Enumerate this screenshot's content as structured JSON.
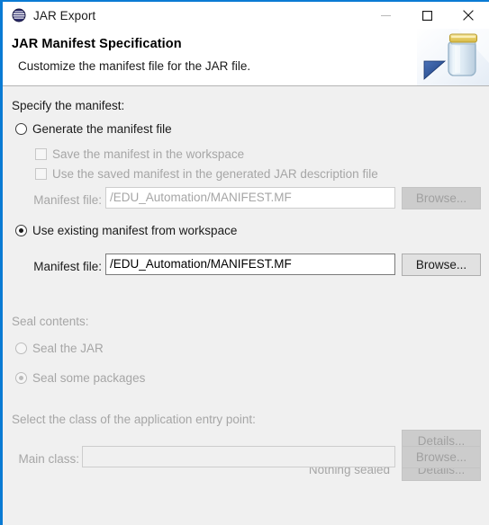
{
  "window": {
    "title": "JAR Export",
    "app_icon": "eclipse-icon",
    "accent_color": "#0a7bd4",
    "controls": {
      "minimize": "minimize-icon",
      "maximize": "maximize-icon",
      "close": "close-icon"
    }
  },
  "header": {
    "title": "JAR Manifest Specification",
    "subtitle": "Customize the manifest file for the JAR file.",
    "banner_icon": "jar-export-icon"
  },
  "manifest_section": {
    "label": "Specify the manifest:",
    "generate_option": {
      "label": "Generate the manifest file",
      "selected": false,
      "enabled": true
    },
    "save_in_workspace": {
      "label": "Save the manifest in the workspace",
      "checked": false,
      "enabled": false
    },
    "use_saved_manifest": {
      "label": "Use the saved manifest in the generated JAR description file",
      "checked": false,
      "enabled": false
    },
    "generate_manifest_file": {
      "label": "Manifest file:",
      "value": "/EDU_Automation/MANIFEST.MF",
      "browse_label": "Browse...",
      "enabled": false
    },
    "use_existing_option": {
      "label": "Use existing manifest from workspace",
      "selected": true,
      "enabled": true
    },
    "existing_manifest_file": {
      "label": "Manifest file:",
      "value": "/EDU_Automation/MANIFEST.MF",
      "browse_label": "Browse...",
      "enabled": true
    }
  },
  "seal_section": {
    "label": "Seal contents:",
    "enabled": false,
    "seal_jar": {
      "label": "Seal the JAR",
      "selected": false,
      "details_label": "Details..."
    },
    "seal_some_packages": {
      "label": "Seal some packages",
      "selected": true,
      "status": "Nothing sealed",
      "details_label": "Details..."
    }
  },
  "entry_point_section": {
    "label": "Select the class of the application entry point:",
    "enabled": false,
    "main_class": {
      "label": "Main class:",
      "value": "",
      "browse_label": "Browse..."
    }
  }
}
